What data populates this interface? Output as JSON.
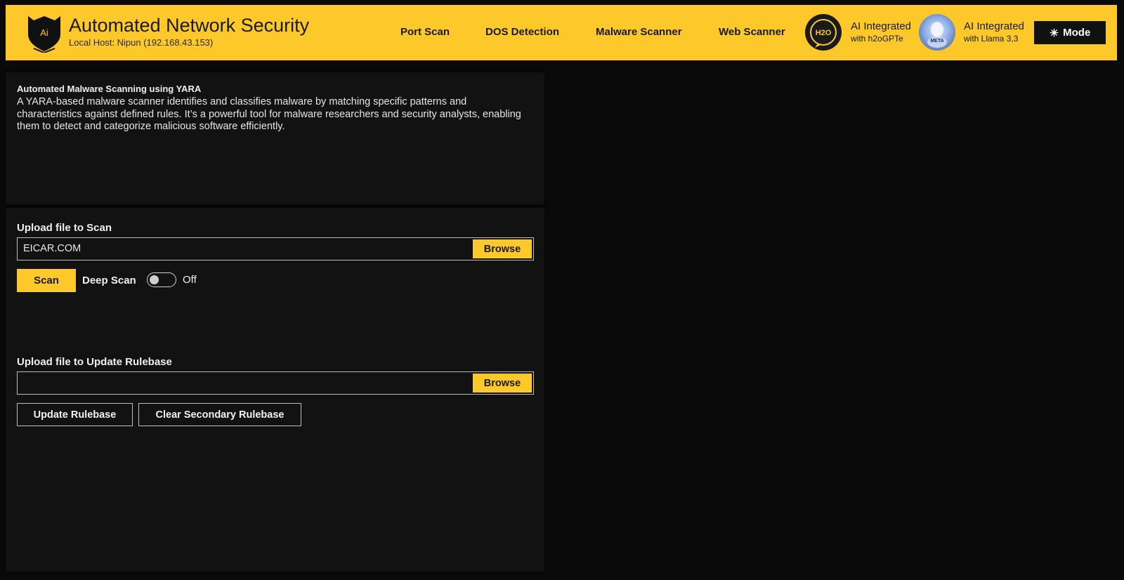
{
  "header": {
    "logo_text": "Ai",
    "title": "Automated Network Security",
    "subtitle": "Local Host: Nipun (192.168.43.153)",
    "nav": [
      {
        "label": "Port Scan"
      },
      {
        "label": "DOS Detection"
      },
      {
        "label": "Malware Scanner"
      },
      {
        "label": "Web Scanner"
      }
    ],
    "ai_badges": [
      {
        "icon": "h2o-logo-icon",
        "logo_text": "H2O",
        "line1": "AI Integrated",
        "line2": "with h2oGPTe"
      },
      {
        "icon": "meta-llama-logo-icon",
        "logo_text": "META",
        "line1": "AI Integrated",
        "line2": "with Llama 3,3"
      }
    ],
    "mode_label": "Mode",
    "mode_icon": "sun-icon"
  },
  "intro": {
    "title": "Automated Malware Scanning using YARA",
    "description": "A YARA-based malware scanner identifies and classifies malware by matching specific patterns and characteristics against defined rules. It’s a powerful tool for malware researchers and security analysts, enabling them to detect and categorize malicious software efficiently."
  },
  "scan": {
    "label": "Upload file to Scan",
    "file_value": "EICAR.COM",
    "browse_label": "Browse",
    "scan_label": "Scan",
    "deep_scan_label": "Deep Scan",
    "deep_scan_state": "Off"
  },
  "rulebase": {
    "label": "Upload file to Update Rulebase",
    "file_value": "",
    "browse_label": "Browse",
    "update_label": "Update Rulebase",
    "clear_label": "Clear Secondary Rulebase"
  },
  "colors": {
    "accent": "#fdc82a",
    "background": "#0a0a0a",
    "panel": "#121212"
  }
}
